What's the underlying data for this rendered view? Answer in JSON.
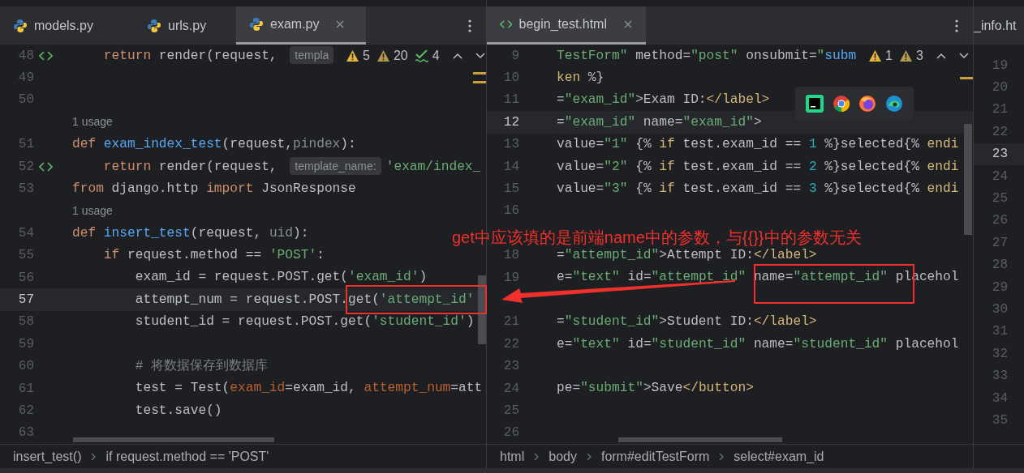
{
  "left_pane": {
    "tabs": [
      {
        "label": "models.py",
        "selected": false,
        "kind": "python"
      },
      {
        "label": "urls.py",
        "selected": false,
        "kind": "python"
      },
      {
        "label": "exam.py",
        "selected": true,
        "kind": "python"
      }
    ],
    "problems": [
      {
        "kind": "warning",
        "count": "5"
      },
      {
        "kind": "weak",
        "count": "20"
      },
      {
        "kind": "typo",
        "count": "4"
      }
    ],
    "lines": [
      {
        "kind": "code",
        "number": "48",
        "gutter_icon": true,
        "current": false,
        "segments": [
          {
            "text": "    return",
            "kind": "kw"
          },
          {
            "text": " render(request, ",
            "kind": "plain"
          },
          {
            "text": "templa",
            "kind": "hint"
          }
        ]
      },
      {
        "kind": "code",
        "number": "49",
        "gutter_icon": false,
        "current": false
      },
      {
        "kind": "code",
        "number": "50",
        "gutter_icon": false,
        "current": false
      },
      {
        "kind": "usage",
        "text": "1 usage"
      },
      {
        "kind": "code",
        "number": "51",
        "gutter_icon": false,
        "current": false,
        "segments": [
          {
            "text": "def",
            "kind": "kw"
          },
          {
            "text": " exam_index_test",
            "kind": "fn"
          },
          {
            "text": "(request,",
            "kind": "plain"
          },
          {
            "text": "pindex",
            "kind": "param"
          },
          {
            "text": "):",
            "kind": "plain"
          }
        ]
      },
      {
        "kind": "code",
        "number": "52",
        "gutter_icon": true,
        "current": false,
        "segments": [
          {
            "text": "    return",
            "kind": "kw"
          },
          {
            "text": " render(request, ",
            "kind": "plain"
          },
          {
            "text": "template_name:",
            "kind": "hint"
          },
          {
            "text": "'exam/index_",
            "kind": "str"
          }
        ]
      },
      {
        "kind": "code",
        "number": "53",
        "gutter_icon": false,
        "current": false,
        "segments": [
          {
            "text": "from",
            "kind": "kw"
          },
          {
            "text": " django.http ",
            "kind": "plain"
          },
          {
            "text": "import",
            "kind": "kw"
          },
          {
            "text": " JsonResponse",
            "kind": "plain"
          }
        ]
      },
      {
        "kind": "usage",
        "text": "1 usage"
      },
      {
        "kind": "code",
        "number": "54",
        "gutter_icon": false,
        "current": false,
        "segments": [
          {
            "text": "def",
            "kind": "kw"
          },
          {
            "text": " insert_test",
            "kind": "fn"
          },
          {
            "text": "(request, ",
            "kind": "plain"
          },
          {
            "text": "uid",
            "kind": "param"
          },
          {
            "text": "):",
            "kind": "plain"
          }
        ]
      },
      {
        "kind": "code",
        "number": "55",
        "gutter_icon": false,
        "current": false,
        "segments": [
          {
            "text": "    if",
            "kind": "kw"
          },
          {
            "text": " request.method == ",
            "kind": "plain"
          },
          {
            "text": "'POST'",
            "kind": "str"
          },
          {
            "text": ":",
            "kind": "plain"
          }
        ]
      },
      {
        "kind": "code",
        "number": "56",
        "gutter_icon": false,
        "current": false,
        "segments": [
          {
            "text": "        exam_id = request.POST.get(",
            "kind": "plain"
          },
          {
            "text": "'exam_id'",
            "kind": "str"
          },
          {
            "text": ")",
            "kind": "plain"
          }
        ]
      },
      {
        "kind": "code",
        "number": "57",
        "gutter_icon": false,
        "current": true,
        "segments": [
          {
            "text": "        attempt_num = request.POST.get(",
            "kind": "plain"
          },
          {
            "text": "'attempt_id'",
            "kind": "str"
          }
        ]
      },
      {
        "kind": "code",
        "number": "58",
        "gutter_icon": false,
        "current": false,
        "segments": [
          {
            "text": "        student_id = request.POST.get(",
            "kind": "plain"
          },
          {
            "text": "'student_id'",
            "kind": "str"
          },
          {
            "text": ")",
            "kind": "plain"
          }
        ]
      },
      {
        "kind": "code",
        "number": "59",
        "gutter_icon": false,
        "current": false
      },
      {
        "kind": "code",
        "number": "60",
        "gutter_icon": false,
        "current": false,
        "segments": [
          {
            "text": "        # 将数据保存到数据库",
            "kind": "comment"
          }
        ]
      },
      {
        "kind": "code",
        "number": "61",
        "gutter_icon": false,
        "current": false,
        "segments": [
          {
            "text": "        test = Test(",
            "kind": "plain"
          },
          {
            "text": "exam_id",
            "kind": "arg"
          },
          {
            "text": "=exam_id, ",
            "kind": "plain"
          },
          {
            "text": "attempt_num",
            "kind": "arg"
          },
          {
            "text": "=att",
            "kind": "plain"
          }
        ]
      },
      {
        "kind": "code",
        "number": "62",
        "gutter_icon": false,
        "current": false,
        "segments": [
          {
            "text": "        test.save()",
            "kind": "plain"
          }
        ]
      },
      {
        "kind": "code",
        "number": "63",
        "gutter_icon": false,
        "current": false
      }
    ],
    "breadcrumbs": [
      "insert_test()",
      "if request.method == 'POST'"
    ]
  },
  "right_pane": {
    "tabs": [
      {
        "label": "begin_test.html",
        "selected": true,
        "kind": "html"
      }
    ],
    "problems": [
      {
        "kind": "warning",
        "count": "1"
      },
      {
        "kind": "weak",
        "count": "3"
      }
    ],
    "lines": [
      {
        "kind": "code",
        "number": "9",
        "current": false,
        "segments": [
          {
            "text": "TestForm\"",
            "kind": "str"
          },
          {
            "text": " method=",
            "kind": "plain"
          },
          {
            "text": "\"post\"",
            "kind": "str"
          },
          {
            "text": " onsubmit=",
            "kind": "plain"
          },
          {
            "text": "\"",
            "kind": "str"
          },
          {
            "text": "subm",
            "kind": "fn"
          }
        ]
      },
      {
        "kind": "code",
        "number": "10",
        "current": false,
        "segments": [
          {
            "text": "ken",
            "kind": "tpl"
          },
          {
            "text": " %}",
            "kind": "plain"
          }
        ]
      },
      {
        "kind": "code",
        "number": "11",
        "current": false,
        "segments": [
          {
            "text": "=",
            "kind": "plain"
          },
          {
            "text": "\"exam_id\"",
            "kind": "str"
          },
          {
            "text": ">Exam ID:",
            "kind": "plain"
          },
          {
            "text": "</label>",
            "kind": "tag"
          }
        ]
      },
      {
        "kind": "code",
        "number": "12",
        "current": true,
        "segments": [
          {
            "text": "=",
            "kind": "plain"
          },
          {
            "text": "\"exam_id\"",
            "kind": "str"
          },
          {
            "text": " name=",
            "kind": "plain"
          },
          {
            "text": "\"exam_id\"",
            "kind": "str"
          },
          {
            "text": ">",
            "kind": "plain"
          }
        ]
      },
      {
        "kind": "code",
        "number": "13",
        "current": false,
        "segments": [
          {
            "text": "value=",
            "kind": "plain"
          },
          {
            "text": "\"1\"",
            "kind": "str"
          },
          {
            "text": " {% ",
            "kind": "plain"
          },
          {
            "text": "if",
            "kind": "tpl"
          },
          {
            "text": " test.exam_id == ",
            "kind": "plain"
          },
          {
            "text": "1",
            "kind": "num"
          },
          {
            "text": " %}selected{% ",
            "kind": "plain"
          },
          {
            "text": "endi",
            "kind": "tpl"
          }
        ]
      },
      {
        "kind": "code",
        "number": "14",
        "current": false,
        "segments": [
          {
            "text": "value=",
            "kind": "plain"
          },
          {
            "text": "\"2\"",
            "kind": "str"
          },
          {
            "text": " {% ",
            "kind": "plain"
          },
          {
            "text": "if",
            "kind": "tpl"
          },
          {
            "text": " test.exam_id == ",
            "kind": "plain"
          },
          {
            "text": "2",
            "kind": "num"
          },
          {
            "text": " %}selected{% ",
            "kind": "plain"
          },
          {
            "text": "endi",
            "kind": "tpl"
          }
        ]
      },
      {
        "kind": "code",
        "number": "15",
        "current": false,
        "segments": [
          {
            "text": "value=",
            "kind": "plain"
          },
          {
            "text": "\"3\"",
            "kind": "str"
          },
          {
            "text": " {% ",
            "kind": "plain"
          },
          {
            "text": "if",
            "kind": "tpl"
          },
          {
            "text": " test.exam_id == ",
            "kind": "plain"
          },
          {
            "text": "3",
            "kind": "num"
          },
          {
            "text": " %}selected{% ",
            "kind": "plain"
          },
          {
            "text": "endi",
            "kind": "tpl"
          }
        ]
      },
      {
        "kind": "code",
        "number": "16",
        "current": false
      },
      {
        "kind": "code",
        "current": false
      },
      {
        "kind": "code",
        "number": "18",
        "current": false,
        "segments": [
          {
            "text": "=",
            "kind": "plain"
          },
          {
            "text": "\"attempt_id\"",
            "kind": "str"
          },
          {
            "text": ">Attempt ID:",
            "kind": "plain"
          },
          {
            "text": "</label>",
            "kind": "tag"
          }
        ]
      },
      {
        "kind": "code",
        "number": "19",
        "current": false,
        "segments": [
          {
            "text": "e=",
            "kind": "plain"
          },
          {
            "text": "\"text\"",
            "kind": "str"
          },
          {
            "text": " id=",
            "kind": "plain"
          },
          {
            "text": "\"attempt_id\"",
            "kind": "str"
          },
          {
            "text": " name=",
            "kind": "plain"
          },
          {
            "text": "\"attempt_id\"",
            "kind": "str"
          },
          {
            "text": " placehol",
            "kind": "plain"
          }
        ]
      },
      {
        "kind": "code",
        "current": false
      },
      {
        "kind": "code",
        "number": "21",
        "current": false,
        "segments": [
          {
            "text": "=",
            "kind": "plain"
          },
          {
            "text": "\"student_id\"",
            "kind": "str"
          },
          {
            "text": ">Student ID:",
            "kind": "plain"
          },
          {
            "text": "</label>",
            "kind": "tag"
          }
        ]
      },
      {
        "kind": "code",
        "number": "22",
        "current": false,
        "segments": [
          {
            "text": "e=",
            "kind": "plain"
          },
          {
            "text": "\"text\"",
            "kind": "str"
          },
          {
            "text": " id=",
            "kind": "plain"
          },
          {
            "text": "\"student_id\"",
            "kind": "str"
          },
          {
            "text": " name=",
            "kind": "plain"
          },
          {
            "text": "\"student_id\"",
            "kind": "str"
          },
          {
            "text": " placehol",
            "kind": "plain"
          }
        ]
      },
      {
        "kind": "code",
        "number": "23",
        "current": false
      },
      {
        "kind": "code",
        "number": "24",
        "current": false,
        "segments": [
          {
            "text": "pe=",
            "kind": "plain"
          },
          {
            "text": "\"submit\"",
            "kind": "str"
          },
          {
            "text": ">Save",
            "kind": "plain"
          },
          {
            "text": "</button>",
            "kind": "tag"
          }
        ]
      },
      {
        "kind": "code",
        "number": "25",
        "current": false
      },
      {
        "kind": "code",
        "number": "26",
        "current": false
      }
    ],
    "breadcrumbs": [
      "html",
      "body",
      "form#editTestForm",
      "select#exam_id"
    ]
  },
  "third_pane": {
    "tab": {
      "label": "_info.ht"
    },
    "lines": [
      {
        "number": "19",
        "current": false
      },
      {
        "number": "20",
        "current": false
      },
      {
        "number": "21",
        "current": false
      },
      {
        "number": "22",
        "current": false
      },
      {
        "number": "23",
        "current": true
      },
      {
        "number": "24",
        "current": false
      },
      {
        "number": "25",
        "current": false
      },
      {
        "number": "26",
        "current": false
      },
      {
        "number": "27",
        "current": false
      },
      {
        "number": "28",
        "current": false
      },
      {
        "number": "29",
        "current": false
      },
      {
        "number": "30",
        "current": false
      },
      {
        "number": "31",
        "current": false
      },
      {
        "number": "32",
        "current": false
      },
      {
        "number": "33",
        "current": false
      },
      {
        "number": "34",
        "current": false
      },
      {
        "number": "35",
        "current": false
      }
    ]
  },
  "annotation": {
    "text": "get中应该填的是前端name中的参数，与{{}}中的参数无关"
  }
}
